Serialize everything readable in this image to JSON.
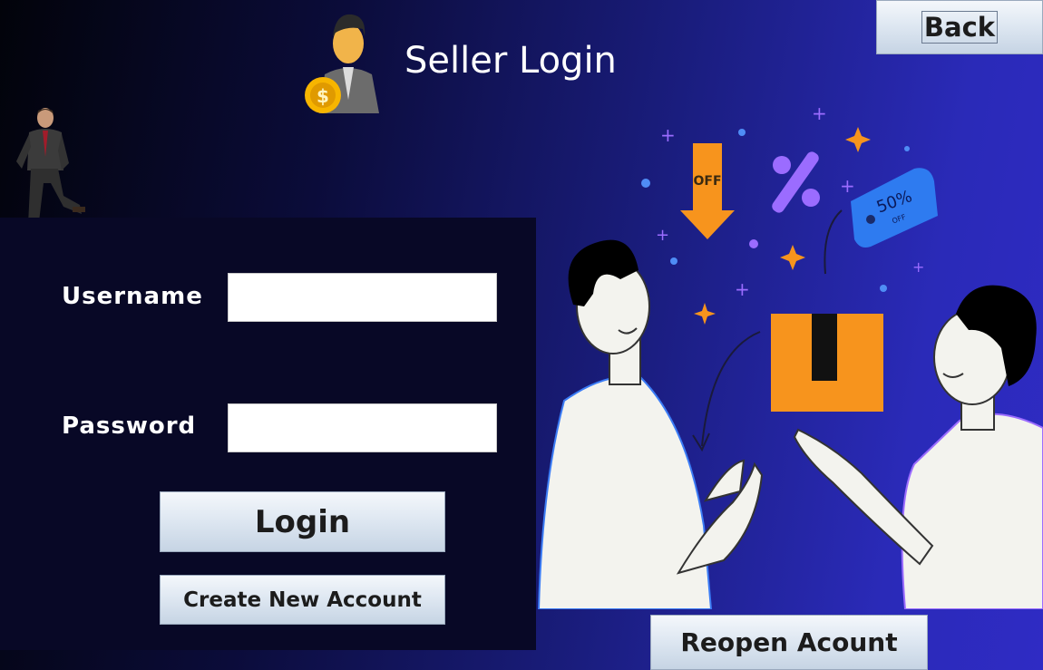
{
  "header": {
    "title": "Seller Login",
    "back_label": "Back"
  },
  "form": {
    "username_label": "Username",
    "username_value": "",
    "password_label": "Password",
    "password_value": "",
    "login_label": "Login",
    "create_account_label": "Create New Account"
  },
  "footer": {
    "reopen_label": "Reopen Acount"
  },
  "illustration": {
    "off_tag": "OFF",
    "discount_tag": "50%",
    "discount_sub": "OFF"
  },
  "colors": {
    "accent_orange": "#f7941d",
    "button_text": "#1c1c1c"
  }
}
